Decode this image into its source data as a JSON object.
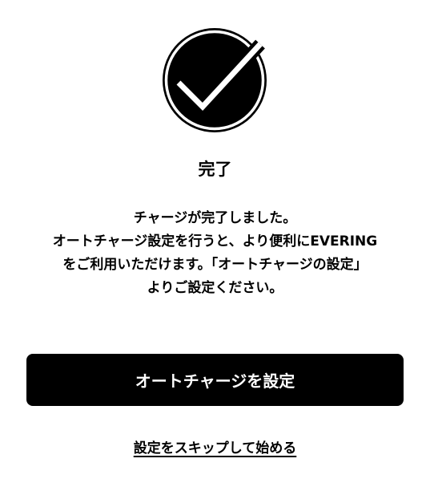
{
  "completion": {
    "icon": "check-circle-icon",
    "title": "完了",
    "message_lines": [
      "チャージが完了しました。",
      "オートチャージ設定を行うと、より便利にEVERING",
      "をご利用いただけます。「オートチャージの設定」",
      "よりご設定ください。"
    ]
  },
  "actions": {
    "primary_label": "オートチャージを設定",
    "skip_label": "設定をスキップして始める"
  },
  "colors": {
    "background": "#ffffff",
    "text": "#000000",
    "button_background": "#000000",
    "button_text": "#ffffff"
  }
}
